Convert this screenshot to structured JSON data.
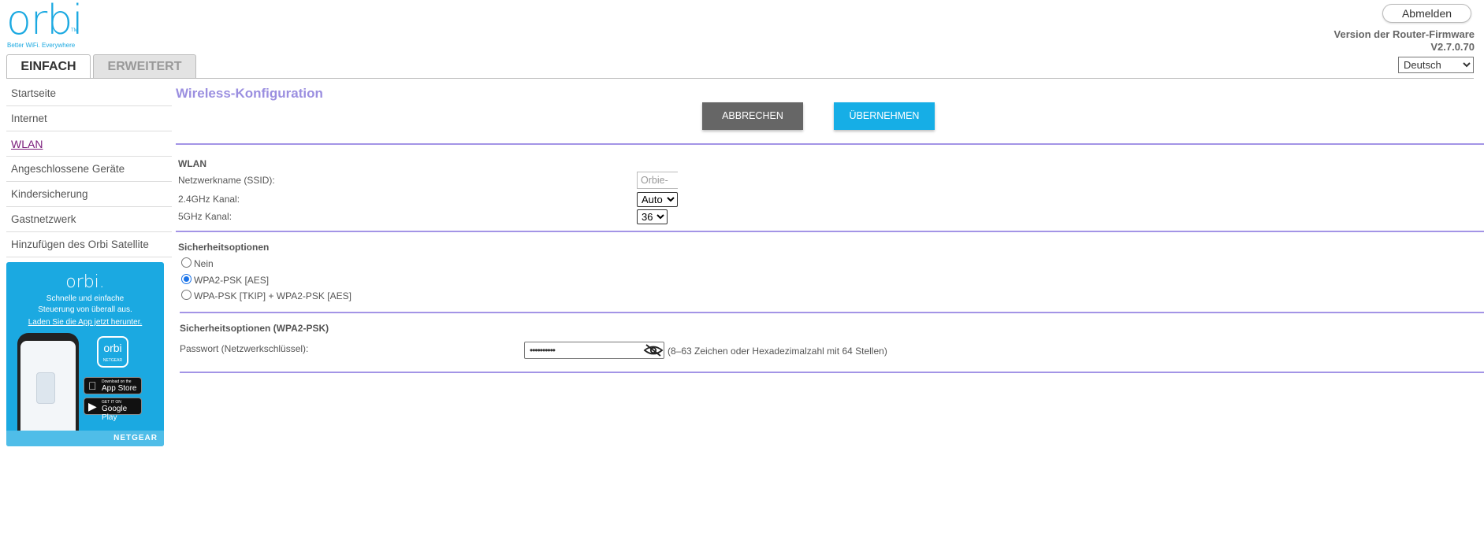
{
  "header": {
    "logo": "orbi",
    "logo_tm": "TM",
    "tagline": "Better WiFi. Everywhere",
    "logout_label": "Abmelden",
    "firmware_label": "Version der Router-Firmware",
    "firmware_version": "V2.7.0.70",
    "language_selected": "Deutsch"
  },
  "tabs": {
    "basic": "EINFACH",
    "advanced": "ERWEITERT"
  },
  "sidebar": {
    "items": [
      {
        "label": "Startseite"
      },
      {
        "label": "Internet"
      },
      {
        "label": "WLAN"
      },
      {
        "label": "Angeschlossene Geräte"
      },
      {
        "label": "Kindersicherung"
      },
      {
        "label": "Gastnetzwerk"
      },
      {
        "label": "Hinzufügen des Orbi Satellite"
      }
    ],
    "active_index": 2
  },
  "promo": {
    "logo": "orbi.",
    "text_line1": "Schnelle und einfache",
    "text_line2": "Steuerung von überall aus.",
    "link": "Laden Sie die App jetzt herunter.",
    "app_icon_label": "orbi",
    "app_icon_sub": "NETGEAR",
    "appstore_small": "Download on the",
    "appstore_big": "App Store",
    "googleplay_small": "GET IT ON",
    "googleplay_big": "Google Play",
    "brand": "NETGEAR",
    "color": "#1ba9e1"
  },
  "main": {
    "title": "Wireless-Konfiguration",
    "cancel_label": "ABBRECHEN",
    "apply_label": "ÜBERNEHMEN",
    "wlan": {
      "heading": "WLAN",
      "ssid_label": "Netzwerkname (SSID):",
      "ssid_value": "Orbie-",
      "ch24_label": "2.4GHz Kanal:",
      "ch24_value": "Auto",
      "ch5_label": "5GHz Kanal:",
      "ch5_value": "36"
    },
    "security": {
      "heading": "Sicherheitsoptionen",
      "options": [
        {
          "label": "Nein",
          "selected": false
        },
        {
          "label": "WPA2-PSK [AES]",
          "selected": true
        },
        {
          "label": "WPA-PSK [TKIP] + WPA2-PSK [AES]",
          "selected": false
        }
      ]
    },
    "wpa2": {
      "heading": "Sicherheitsoptionen (WPA2-PSK)",
      "password_label": "Passwort (Netzwerkschlüssel):",
      "password_dots": "••••••••••",
      "hint": "(8–63 Zeichen oder Hexadezimalzahl mit 64 Stellen)"
    }
  },
  "colors": {
    "accent": "#1ba9e1",
    "title": "#9b8fe0",
    "divider": "#a394e6",
    "active_nav": "#7a1b7a",
    "cancel_button": "#666666",
    "apply_button": "#16aee6"
  }
}
